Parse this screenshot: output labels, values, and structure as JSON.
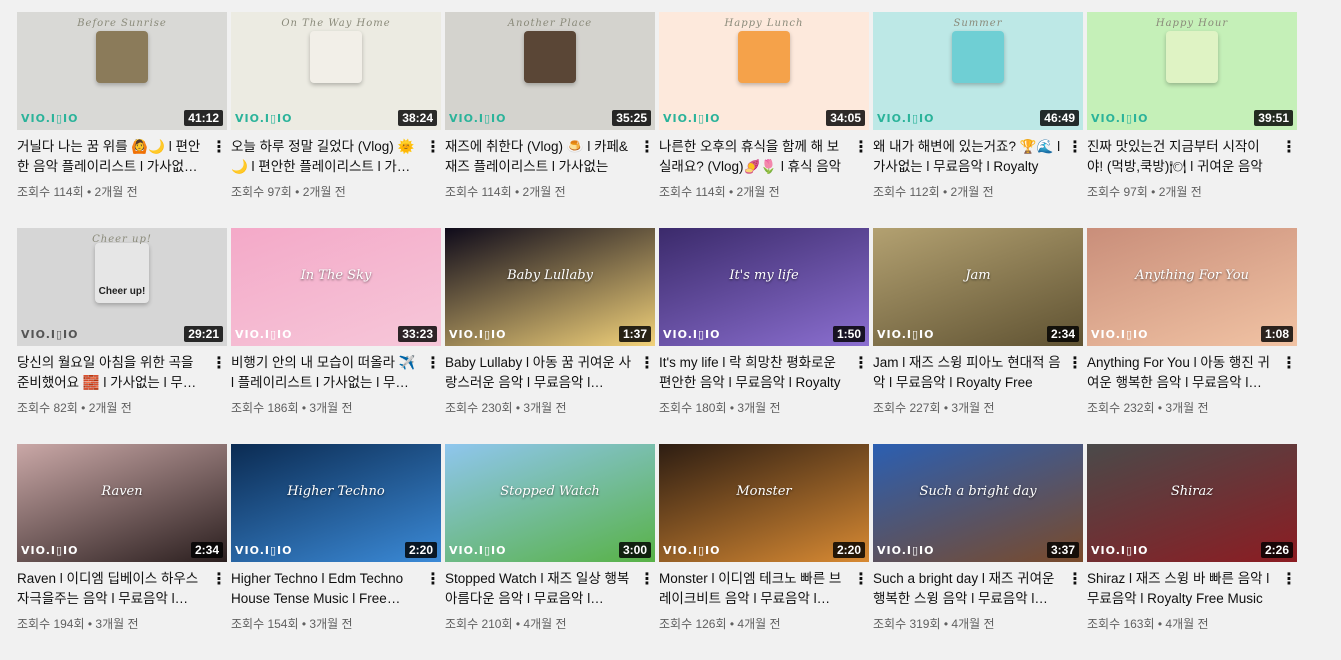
{
  "logo_text": "VIO.I▯IO",
  "videos": [
    {
      "thumb_title": "Before Sunrise",
      "duration": "41:12",
      "title": "거닐다 나는 꿈 위를 🙆🌙 l 편안한 음악 플레이리스트 l 가사없는 l 무료음악",
      "views": "조회수 114회",
      "age": "2개월 전",
      "bg": "#d9d9d6",
      "accent": "#8b7b5a"
    },
    {
      "thumb_title": "On The Way Home",
      "duration": "38:24",
      "title": "오늘 하루 정말 길었다 (Vlog) 🌞🌙 l 편안한 플레이리스트 l 가사없는",
      "views": "조회수 97회",
      "age": "2개월 전",
      "bg": "#ecebe2",
      "accent": "#f2efe8"
    },
    {
      "thumb_title": "Another Place",
      "duration": "35:25",
      "title": "재즈에 취한다 (Vlog) 🍮 l 카페&재즈 플레이리스트 l 가사없는",
      "views": "조회수 114회",
      "age": "2개월 전",
      "bg": "#d4d3ce",
      "accent": "#5a4636"
    },
    {
      "thumb_title": "Happy Lunch",
      "duration": "34:05",
      "title": "나른한 오후의 휴식을 함께 해 보실래요? (Vlog)🍠🌷 l 휴식 음악",
      "views": "조회수 114회",
      "age": "2개월 전",
      "bg": "#fde9dc",
      "accent": "#f5a24a"
    },
    {
      "thumb_title": "Summer",
      "duration": "46:49",
      "title": "왜 내가 해변에 있는거죠? 🏆🌊 l 가사없는 l 무료음악 l Royalty",
      "views": "조회수 112회",
      "age": "2개월 전",
      "bg": "#bde8e6",
      "accent": "#6fcfd4"
    },
    {
      "thumb_title": "Happy Hour",
      "duration": "39:51",
      "title": "진짜 맛있는건 지금부터 시작이야! (먹방,쿡방)🍽 l 귀여운 음악",
      "views": "조회수 97회",
      "age": "2개월 전",
      "bg": "#c5f0b8",
      "accent": "#dff3c4"
    },
    {
      "thumb_title": "Cheer up!",
      "duration": "29:21",
      "title": "당신의 월요일 아침을 위한 곡을 준비했어요 🧱 l 가사없는 l 무료음악",
      "views": "조회수 82회",
      "age": "2개월 전",
      "bg": "#d6d6d6",
      "accent": "#e6e6e6",
      "sticker_text": "Cheer up!"
    },
    {
      "thumb_title": "In The Sky",
      "duration": "33:23",
      "title": "비행기 안의 내 모습이 떠올라 ✈️ l 플레이리스트 l 가사없는 l 무료음악",
      "views": "조회수 186회",
      "age": "3개월 전",
      "bg": "#f4a9c8",
      "accent": "#f6c7d9"
    },
    {
      "thumb_title": "Baby Lullaby",
      "duration": "1:37",
      "title": "Baby Lullaby l 아동 꿈 귀여운 사랑스러운 음악 l 무료음악 l Royalty",
      "views": "조회수 230회",
      "age": "3개월 전",
      "bg": "#0e0a1a",
      "accent": "#f2d27a"
    },
    {
      "thumb_title": "It's my life",
      "duration": "1:50",
      "title": "It's my life l 락 희망찬 평화로운 편안한 음악 l 무료음악 l Royalty",
      "views": "조회수 180회",
      "age": "3개월 전",
      "bg": "#3b2a6b",
      "accent": "#8b6fd0"
    },
    {
      "thumb_title": "Jam",
      "duration": "2:34",
      "title": "Jam l 재즈 스윙 피아노 현대적 음악 l 무료음악 l Royalty Free",
      "views": "조회수 227회",
      "age": "3개월 전",
      "bg": "#b3a171",
      "accent": "#5f5232"
    },
    {
      "thumb_title": "Anything For You",
      "duration": "1:08",
      "title": "Anything For You l 아동 행진 귀여운 행복한 음악 l 무료음악 l Royalty",
      "views": "조회수 232회",
      "age": "3개월 전",
      "bg": "#c98e7a",
      "accent": "#f1c3a4"
    },
    {
      "thumb_title": "Raven",
      "duration": "2:34",
      "title": "Raven l 이디엠 딥베이스 하우스 자극을주는 음악 l 무료음악 l Royalty",
      "views": "조회수 194회",
      "age": "3개월 전",
      "bg": "#caa8a7",
      "accent": "#2a1e1e"
    },
    {
      "thumb_title": "Higher Techno",
      "duration": "2:20",
      "title": "Higher Techno l Edm Techno House Tense Music l Free Music l Royalty",
      "views": "조회수 154회",
      "age": "3개월 전",
      "bg": "#0b2b52",
      "accent": "#3b8ad7"
    },
    {
      "thumb_title": "Stopped Watch",
      "duration": "3:00",
      "title": "Stopped Watch l 재즈 일상 행복 아름다운 음악 l 무료음악 l Royalty",
      "views": "조회수 210회",
      "age": "4개월 전",
      "bg": "#8fc6ee",
      "accent": "#58b246"
    },
    {
      "thumb_title": "Monster",
      "duration": "2:20",
      "title": "Monster l 이디엠 테크노 빠른 브레이크비트 음악 l 무료음악 l Royalty",
      "views": "조회수 126회",
      "age": "4개월 전",
      "bg": "#2d1d12",
      "accent": "#d88a33"
    },
    {
      "thumb_title": "Such a bright day",
      "duration": "3:37",
      "title": "Such a bright day l 재즈 귀여운 행복한 스윙 음악 l 무료음악 l Royalty",
      "views": "조회수 319회",
      "age": "4개월 전",
      "bg": "#2b5fb2",
      "accent": "#7a4a2a"
    },
    {
      "thumb_title": "Shiraz",
      "duration": "2:26",
      "title": "Shiraz l 재즈 스윙 바 빠른 음악 l 무료음악 l Royalty Free Music",
      "views": "조회수 163회",
      "age": "4개월 전",
      "bg": "#4a4a4a",
      "accent": "#8c1c22"
    }
  ]
}
